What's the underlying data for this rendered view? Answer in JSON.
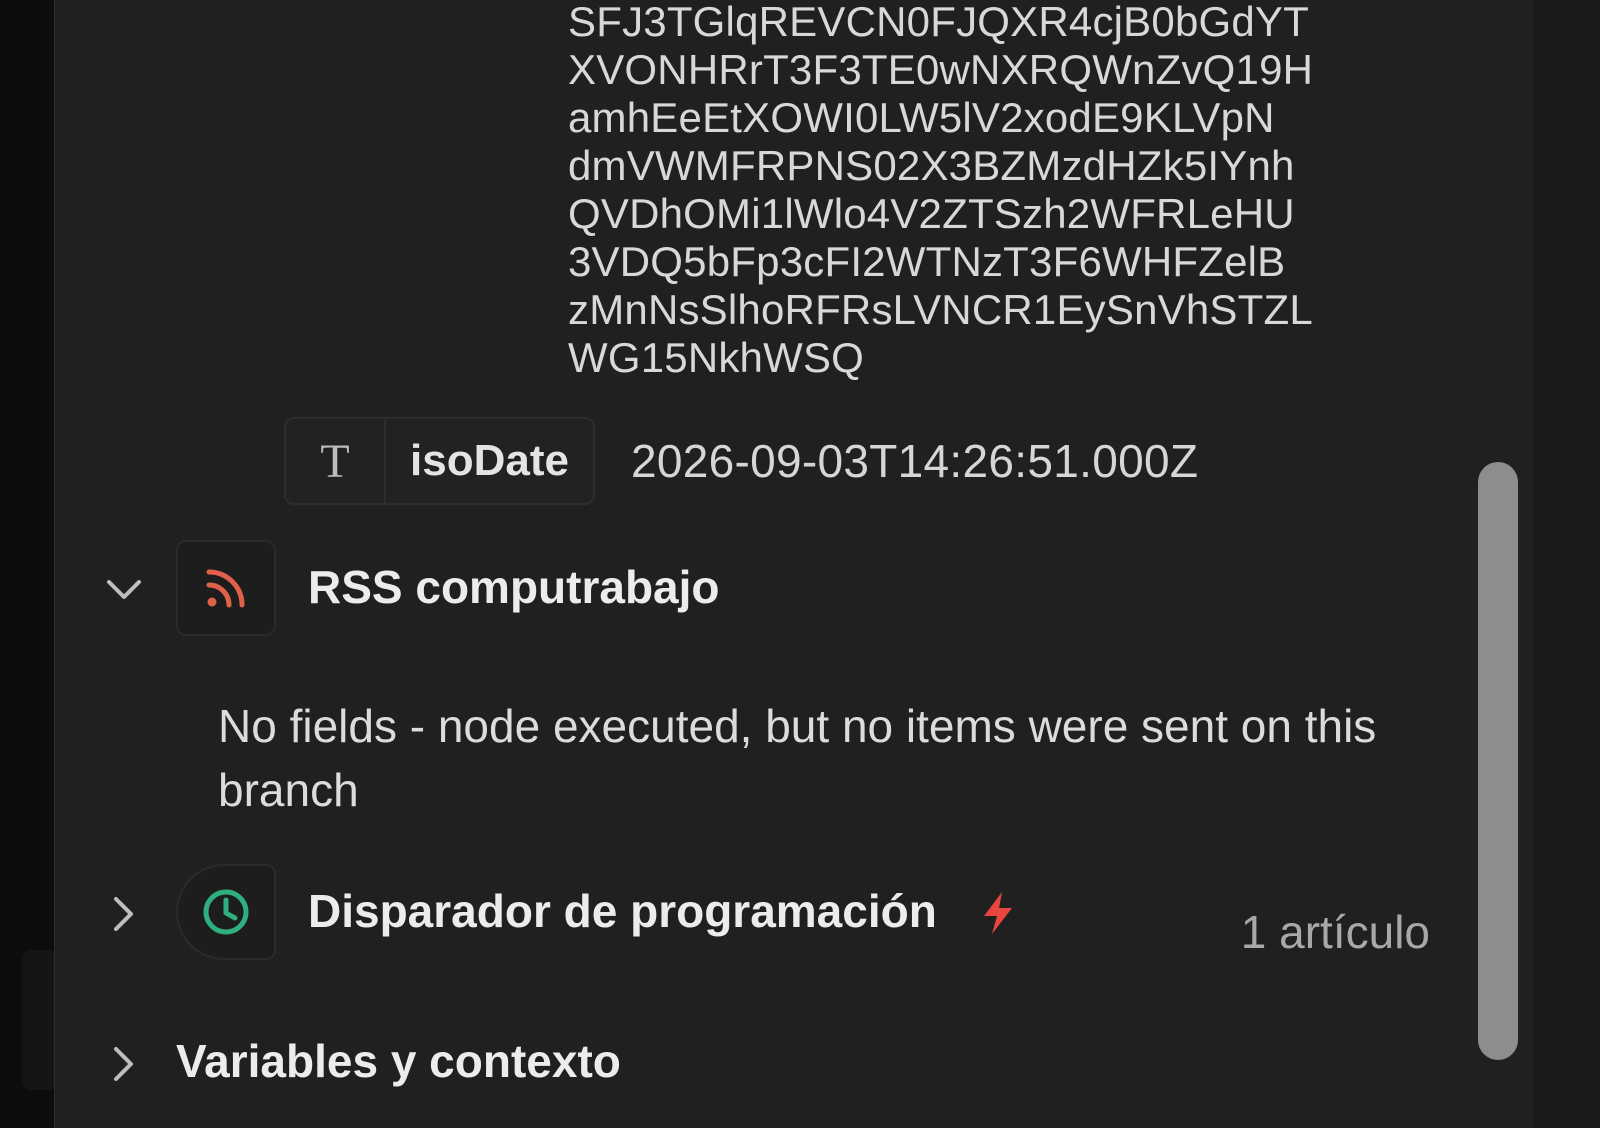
{
  "token_lines": [
    "SFJ3TGlqREVCN0FJQXR4cjB0bGdYT",
    "XVONHRrT3F3TE0wNXRQWnZvQ19H",
    "amhEeEtXOWI0LW5lV2xodE9KLVpN",
    "dmVWMFRPNS02X3BZMzdHZk5IYnh",
    "QVDhOMi1lWlo4V2ZTSzh2WFRLeHU",
    "3VDQ5bFp3cFI2WTNzT3F6WHFZelB",
    "zMnNsSlhoRFRsLVNCR1EySnVhSTZL",
    "WG15NkhWSQ"
  ],
  "field": {
    "type_icon": "T",
    "key": "isoDate",
    "value": "2026-09-03T14:26:51.000Z"
  },
  "nodes": [
    {
      "title": "RSS computrabajo",
      "icon": "rss-icon",
      "icon_color": "#e0604a",
      "expanded": true,
      "message": "No fields - node executed, but no items were sent on this branch"
    },
    {
      "title": "Disparador de programación",
      "icon": "clock-icon",
      "icon_color": "#2fae7e",
      "badge_icon": "lightning-icon",
      "badge_color": "#e8463e",
      "expanded": false,
      "count": "1 artículo"
    }
  ],
  "section": {
    "title": "Variables y contexto",
    "expanded": false
  },
  "colors": {
    "panel_bg": "#202020",
    "text": "#e4e4e4",
    "muted": "#a8a8a8",
    "scroll_thumb": "#8d8d8d"
  }
}
